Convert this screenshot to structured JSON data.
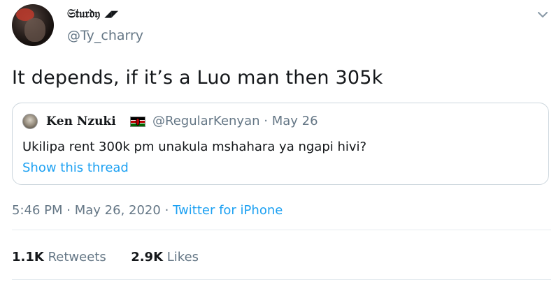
{
  "author": {
    "display_name": "𝔖𝔱𝔲𝔯𝔡𝔶",
    "name_symbols": "◢◤",
    "handle": "@Ty_charry"
  },
  "tweet": {
    "text": "It depends, if it’s a Luo man then 305k"
  },
  "quoted": {
    "display_name": "𝐊𝐞𝐧 𝐍𝐳𝐮𝐤𝐢",
    "handle": "@RegularKenyan",
    "separator": "·",
    "date": "May 26",
    "text": "Ukilipa rent 300k pm unakula mshahara ya ngapi hivi?",
    "show_thread": "Show this thread"
  },
  "meta": {
    "time": "5:46 PM",
    "separator": "·",
    "date": "May 26, 2020",
    "source": "Twitter for iPhone"
  },
  "stats": {
    "retweets_count": "1.1K",
    "retweets_label": "Retweets",
    "likes_count": "2.9K",
    "likes_label": "Likes"
  },
  "colors": {
    "link": "#1da1f2",
    "secondary_text": "#657786",
    "border": "#ccd6dd"
  },
  "icons": {
    "menu": "chevron-down-icon",
    "flag": "kenya-flag-icon"
  }
}
